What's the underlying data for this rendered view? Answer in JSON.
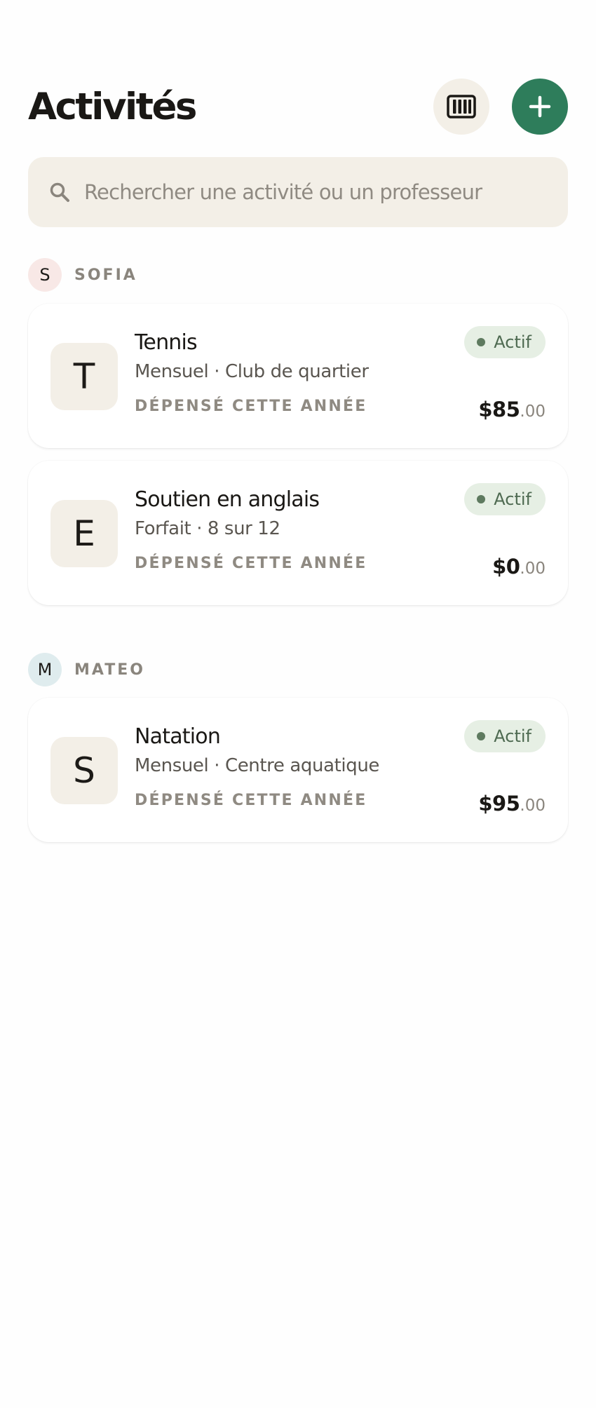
{
  "header": {
    "title": "Activités",
    "columns_button_icon": "columns-icon",
    "add_button_icon": "plus-icon"
  },
  "search": {
    "placeholder": "Rechercher une activité ou un professeur",
    "value": "",
    "icon": "search-icon"
  },
  "colors": {
    "accent": "#2e7d5b",
    "status_active_bg": "#e6efe4",
    "status_active_text": "#4e6a51",
    "tile_bg": "#f3efe7"
  },
  "groups": [
    {
      "initial": "S",
      "name": "SOFIA",
      "activities": [
        {
          "initial": "T",
          "title": "Tennis",
          "subtitle": "Mensuel · Club de quartier",
          "spent_label": "DÉPENSÉ CETTE ANNÉE",
          "status": "Actif",
          "amount_main": "$85",
          "amount_cents": ".00"
        },
        {
          "initial": "E",
          "title": "Soutien en anglais",
          "subtitle": "Forfait · 8 sur 12",
          "spent_label": "DÉPENSÉ CETTE ANNÉE",
          "status": "Actif",
          "amount_main": "$0",
          "amount_cents": ".00"
        }
      ]
    },
    {
      "initial": "M",
      "name": "MATEO",
      "activities": [
        {
          "initial": "S",
          "title": "Natation",
          "subtitle": "Mensuel · Centre aquatique",
          "spent_label": "DÉPENSÉ CETTE ANNÉE",
          "status": "Actif",
          "amount_main": "$95",
          "amount_cents": ".00"
        }
      ]
    }
  ]
}
